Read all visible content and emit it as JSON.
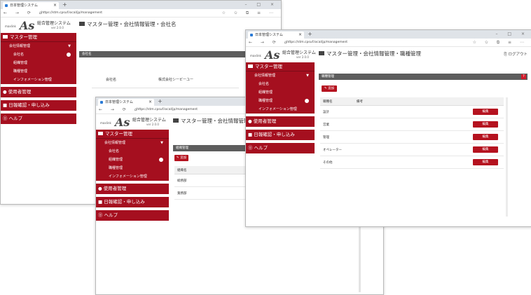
{
  "browser": {
    "tab_title": "日本管理システム",
    "tab_close": "×",
    "new_tab": "+",
    "window_controls": "–  □  ×",
    "nav_icons": "← → ⟳ ⌂",
    "url": "https://stm.cpsuf.local/jp/management",
    "toolbar_icons": "☆ ✩ ⧉ ≡ ⋯"
  },
  "app": {
    "logo_prefix": "maxlink",
    "logo_mark": "As",
    "system_name": "総合管理システム",
    "version": "ver 2.0.0",
    "logout": "ログアウト"
  },
  "sidebar": {
    "master": "マスター管理",
    "company_info": "会社情報管理",
    "caret": "▼",
    "company_name": "会社名",
    "department": "組織管理",
    "position": "職種管理",
    "information": "インフォメーション管理",
    "user_management": "使用者管理",
    "confirm": "日報確認・申し込み",
    "help": "ヘルプ"
  },
  "windows": {
    "back": {
      "title": "マスター管理・会社情報管理・会社名",
      "panel_label": "会社名",
      "field_label": "会社名",
      "field_value": "株式会社シービーユー"
    },
    "middle": {
      "title": "マスター管理・会社情報管理・組織管理",
      "panel_label": "組織管理",
      "add_button": "追加",
      "column": "組織名",
      "rows": [
        "総務部",
        "業務部"
      ]
    },
    "front": {
      "title": "マスター管理・会社情報管理・職種管理",
      "panel_label": "職種管理",
      "help_badge": "?",
      "add_button": "追加",
      "columns": [
        "職種名",
        "備考"
      ],
      "rows": [
        "設計",
        "営業",
        "管理",
        "オペレーター",
        "その他"
      ],
      "edit_label": "編集"
    }
  },
  "colors": {
    "accent": "#a50f1f",
    "button": "#b5121f",
    "panel_header": "#5d5d5d"
  }
}
